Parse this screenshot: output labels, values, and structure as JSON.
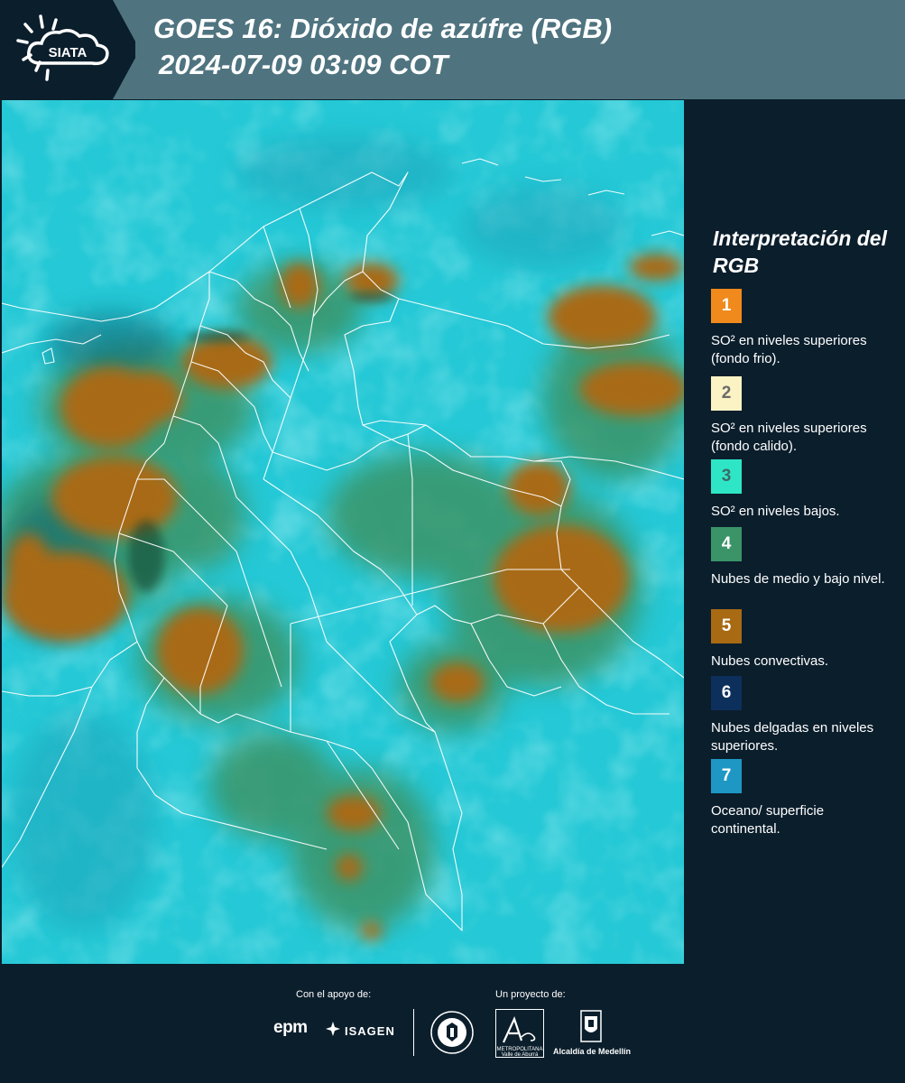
{
  "header": {
    "logo_text": "SIATA",
    "title_line1": "GOES 16: Dióxido de azúfre (RGB)",
    "title_line2": "2024-07-09 03:09 COT"
  },
  "legend": {
    "title": "Interpretación del RGB",
    "items": [
      {
        "num": "1",
        "label": "SO² en niveles superiores (fondo frio).",
        "color": "#f08a1c",
        "text_color": "#ffffff"
      },
      {
        "num": "2",
        "label": "SO² en niveles superiores (fondo calido).",
        "color": "#fbf3c4",
        "text_color": "#6b6b6b"
      },
      {
        "num": "3",
        "label": "SO² en niveles bajos.",
        "color": "#2ee6c6",
        "text_color": "#3b6b66"
      },
      {
        "num": "4",
        "label": "Nubes de medio y bajo nivel.",
        "color": "#3a9468",
        "text_color": "#ffffff"
      },
      {
        "num": "5",
        "label": "Nubes convectivas.",
        "color": "#a86a12",
        "text_color": "#ffffff"
      },
      {
        "num": "6",
        "label": "Nubes delgadas en niveles superiores.",
        "color": "#0d2f5c",
        "text_color": "#ffffff"
      },
      {
        "num": "7",
        "label": "Oceano/ superficie continental.",
        "color": "#1e97c4",
        "text_color": "#ffffff"
      }
    ]
  },
  "footer": {
    "support_label": "Con el apoyo de:",
    "project_label": "Un proyecto de:",
    "epm": "epm",
    "isagen": "ISAGEN",
    "area_text": "METROPOLITANA Valle de Aburrá",
    "alcaldia": "Alcaldía de Medellín"
  },
  "colors": {
    "header_bg": "#4f7480",
    "background": "#0b1e2c",
    "map_base": "#25c8d6",
    "cloud_convective": "#a86a12",
    "cloud_green": "#3a9468"
  }
}
